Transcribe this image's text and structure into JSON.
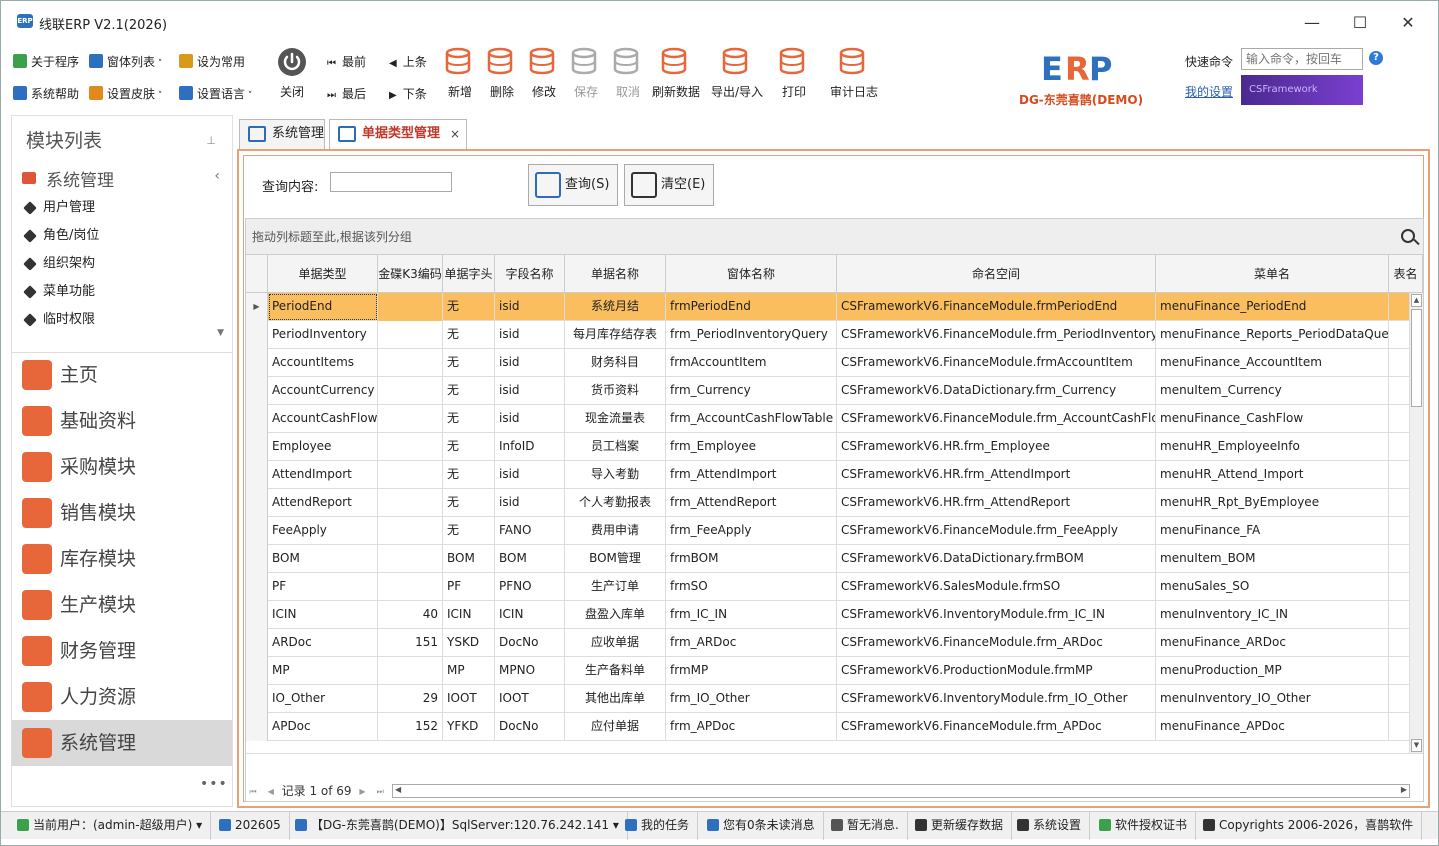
{
  "window": {
    "title": "线联ERP V2.1(2026)",
    "minimize": "—",
    "maximize": "☐",
    "close": "✕",
    "app_icon_text": "ERP"
  },
  "ribbon": {
    "small": [
      {
        "label": "关于程序",
        "name": "about-button",
        "icon": "info-icon",
        "color": "#3aa04a"
      },
      {
        "label": "窗体列表",
        "name": "window-list-button",
        "icon": "windows-icon",
        "color": "#2f6fc0",
        "dropdown": true
      },
      {
        "label": "设为常用",
        "name": "set-favorite-button",
        "icon": "clipboard-icon",
        "color": "#d99a1c"
      },
      {
        "label": "系统帮助",
        "name": "help-button",
        "icon": "help-icon",
        "color": "#2f6fc0"
      },
      {
        "label": "设置皮肤",
        "name": "skin-button",
        "icon": "palette-icon",
        "color": "#e08a1c",
        "dropdown": true
      },
      {
        "label": "设置语言",
        "name": "language-button",
        "icon": "language-icon",
        "color": "#2f6fc0",
        "dropdown": true
      }
    ],
    "close_label": "关闭",
    "nav": {
      "first": "最前",
      "prev": "上条",
      "last": "最后",
      "next": "下条"
    },
    "big": [
      {
        "label": "新增",
        "name": "add-button",
        "icon": "database-add-icon",
        "color": "#e8673a",
        "disabled": false
      },
      {
        "label": "删除",
        "name": "delete-button",
        "icon": "database-delete-icon",
        "color": "#e8673a",
        "disabled": false
      },
      {
        "label": "修改",
        "name": "edit-button",
        "icon": "database-edit-icon",
        "color": "#e8673a",
        "disabled": false
      },
      {
        "label": "保存",
        "name": "save-button",
        "icon": "save-icon",
        "color": "#aaaaaa",
        "disabled": true
      },
      {
        "label": "取消",
        "name": "cancel-button",
        "icon": "cancel-icon",
        "color": "#aaaaaa",
        "disabled": true
      },
      {
        "label": "刷新数据",
        "name": "refresh-button",
        "icon": "refresh-icon",
        "color": "#e8673a",
        "disabled": false
      },
      {
        "label": "导出/导入",
        "name": "export-import-button",
        "icon": "export-icon",
        "color": "#e8673a",
        "disabled": false
      },
      {
        "label": "打印",
        "name": "print-button",
        "icon": "print-icon",
        "color": "#e8673a",
        "disabled": false
      },
      {
        "label": "审计日志",
        "name": "audit-log-button",
        "icon": "audit-log-icon",
        "color": "#e8673a",
        "disabled": false
      }
    ],
    "brand": "DG-东莞喜鹊(DEMO)",
    "quick_label": "快速命令",
    "quick_placeholder": "输入命令，按回车",
    "my_settings": "我的设置",
    "csframework": "CSFramework"
  },
  "sidebar": {
    "title": "模块列表",
    "pin": "ᵖ",
    "group": "系统管理",
    "sub_items": [
      "用户管理",
      "角色/岗位",
      "组织架构",
      "菜单功能",
      "临时权限"
    ],
    "modules": [
      {
        "label": "主页",
        "name": "module-home",
        "icon": "home-icon",
        "color": "#e8673a"
      },
      {
        "label": "基础资料",
        "name": "module-basic-data",
        "icon": "folder-icon",
        "color": "#e8673a"
      },
      {
        "label": "采购模块",
        "name": "module-purchase",
        "icon": "cart-icon",
        "color": "#e8673a"
      },
      {
        "label": "销售模块",
        "name": "module-sales",
        "icon": "shopping-bag-icon",
        "color": "#e8673a"
      },
      {
        "label": "库存模块",
        "name": "module-inventory",
        "icon": "warehouse-icon",
        "color": "#e8673a"
      },
      {
        "label": "生产模块",
        "name": "module-production",
        "icon": "gears-icon",
        "color": "#e8673a"
      },
      {
        "label": "财务管理",
        "name": "module-finance",
        "icon": "money-bag-icon",
        "color": "#e8673a"
      },
      {
        "label": "人力资源",
        "name": "module-hr",
        "icon": "people-icon",
        "color": "#e8673a"
      },
      {
        "label": "系统管理",
        "name": "module-system",
        "icon": "settings-box-icon",
        "color": "#e8673a",
        "active": true
      }
    ],
    "more": "•••"
  },
  "tabs": [
    {
      "label": "系统管理",
      "selected": false
    },
    {
      "label": "单据类型管理",
      "selected": true,
      "close": "×"
    }
  ],
  "query": {
    "label": "查询内容:",
    "value": "",
    "search_btn": "查询(S)",
    "clear_btn": "清空(E)"
  },
  "grid": {
    "group_hint": "拖动列标题至此,根据该列分组",
    "columns": [
      "单据类型",
      "金碟K3编码",
      "单据字头",
      "字段名称",
      "单据名称",
      "窗体名称",
      "命名空间",
      "菜单名",
      "表名"
    ],
    "rows": [
      [
        "PeriodEnd",
        "",
        "无",
        "isid",
        "系统月结",
        "frmPeriodEnd",
        "CSFrameworkV6.FinanceModule.frmPeriodEnd",
        "menuFinance_PeriodEnd"
      ],
      [
        "PeriodInventory",
        "",
        "无",
        "isid",
        "每月库存结存表",
        "frm_PeriodInventoryQuery",
        "CSFrameworkV6.FinanceModule.frm_PeriodInventoryQ...",
        "menuFinance_Reports_PeriodDataQuery"
      ],
      [
        "AccountItems",
        "",
        "无",
        "isid",
        "财务科目",
        "frmAccountItem",
        "CSFrameworkV6.FinanceModule.frmAccountItem",
        "menuFinance_AccountItem"
      ],
      [
        "AccountCurrency",
        "",
        "无",
        "isid",
        "货币资料",
        "frm_Currency",
        "CSFrameworkV6.DataDictionary.frm_Currency",
        "menuItem_Currency"
      ],
      [
        "AccountCashFlow",
        "",
        "无",
        "isid",
        "现金流量表",
        "frm_AccountCashFlowTable",
        "CSFrameworkV6.FinanceModule.frm_AccountCashFlow...",
        "menuFinance_CashFlow"
      ],
      [
        "Employee",
        "",
        "无",
        "InfoID",
        "员工档案",
        "frm_Employee",
        "CSFrameworkV6.HR.frm_Employee",
        "menuHR_EmployeeInfo"
      ],
      [
        "AttendImport",
        "",
        "无",
        "isid",
        "导入考勤",
        "frm_AttendImport",
        "CSFrameworkV6.HR.frm_AttendImport",
        "menuHR_Attend_Import"
      ],
      [
        "AttendReport",
        "",
        "无",
        "isid",
        "个人考勤报表",
        "frm_AttendReport",
        "CSFrameworkV6.HR.frm_AttendReport",
        "menuHR_Rpt_ByEmployee"
      ],
      [
        "FeeApply",
        "",
        "无",
        "FANO",
        "费用申请",
        "frm_FeeApply",
        "CSFrameworkV6.FinanceModule.frm_FeeApply",
        "menuFinance_FA"
      ],
      [
        "BOM",
        "",
        "BOM",
        "BOM",
        "BOM管理",
        "frmBOM",
        "CSFrameworkV6.DataDictionary.frmBOM",
        "menuItem_BOM"
      ],
      [
        "PF",
        "",
        "PF",
        "PFNO",
        "生产订单",
        "frmSO",
        "CSFrameworkV6.SalesModule.frmSO",
        "menuSales_SO"
      ],
      [
        "ICIN",
        "40",
        "ICIN",
        "ICIN",
        "盘盈入库单",
        "frm_IC_IN",
        "CSFrameworkV6.InventoryModule.frm_IC_IN",
        "menuInventory_IC_IN"
      ],
      [
        "ARDoc",
        "151",
        "YSKD",
        "DocNo",
        "应收单据",
        "frm_ARDoc",
        "CSFrameworkV6.FinanceModule.frm_ARDoc",
        "menuFinance_ARDoc"
      ],
      [
        "MP",
        "",
        "MP",
        "MPNO",
        "生产备料单",
        "frmMP",
        "CSFrameworkV6.ProductionModule.frmMP",
        "menuProduction_MP"
      ],
      [
        "IO_Other",
        "29",
        "IOOT",
        "IOOT",
        "其他出库单",
        "frm_IO_Other",
        "CSFrameworkV6.InventoryModule.frm_IO_Other",
        "menuInventory_IO_Other"
      ],
      [
        "APDoc",
        "152",
        "YFKD",
        "DocNo",
        "应付单据",
        "frm_APDoc",
        "CSFrameworkV6.FinanceModule.frm_APDoc",
        "menuFinance_APDoc"
      ]
    ],
    "record_text": "记录 1 of 69"
  },
  "statusbar": [
    {
      "label": "当前用户：(admin-超级用户) ▾",
      "name": "status-user",
      "icon": "user-icon",
      "color": "#3aa04a"
    },
    {
      "label": "202605",
      "name": "status-period",
      "icon": "calendar-icon",
      "color": "#2f6fc0"
    },
    {
      "label": "【DG-东莞喜鹊(DEMO)】SqlServer:120.76.242.141 ▾",
      "name": "status-db",
      "icon": "database-icon",
      "color": "#2f6fc0"
    },
    {
      "label": "我的任务",
      "name": "status-tasks",
      "icon": "task-icon",
      "color": "#2f6fc0"
    },
    {
      "label": "您有0条未读消息",
      "name": "status-messages",
      "icon": "message-icon",
      "color": "#2f6fc0"
    },
    {
      "label": "暂无消息.",
      "name": "status-notice",
      "icon": "speaker-icon",
      "color": "#555555"
    },
    {
      "label": "更新缓存数据",
      "name": "status-refresh-cache",
      "icon": "refresh-icon",
      "color": "#333333"
    },
    {
      "label": "系统设置",
      "name": "status-settings",
      "icon": "tools-icon",
      "color": "#333333"
    },
    {
      "label": "软件授权证书",
      "name": "status-license",
      "icon": "certificate-icon",
      "color": "#3aa04a"
    },
    {
      "label": "Copyrights 2006-2026，喜鹊软件",
      "name": "status-copyright",
      "icon": "cube-icon",
      "color": "#333333"
    }
  ]
}
